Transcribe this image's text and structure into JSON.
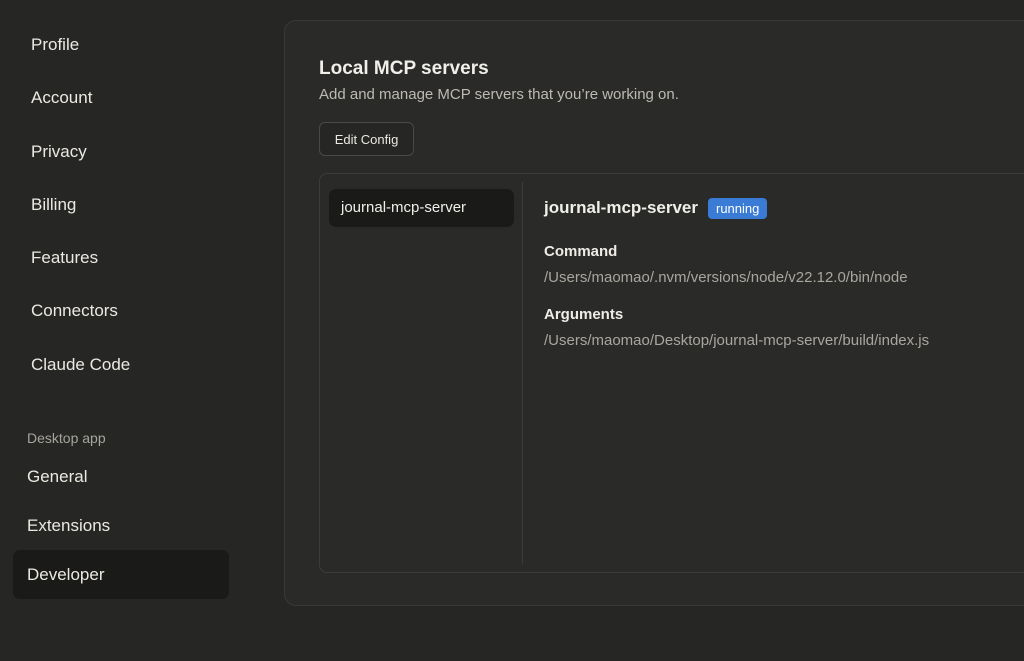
{
  "sidebar": {
    "items": [
      {
        "label": "Profile"
      },
      {
        "label": "Account"
      },
      {
        "label": "Privacy"
      },
      {
        "label": "Billing"
      },
      {
        "label": "Features"
      },
      {
        "label": "Connectors"
      },
      {
        "label": "Claude Code"
      }
    ],
    "section_label": "Desktop app",
    "app_items": [
      {
        "label": "General"
      },
      {
        "label": "Extensions"
      },
      {
        "label": "Developer",
        "active": true
      }
    ]
  },
  "main": {
    "title": "Local MCP servers",
    "subtitle": "Add and manage MCP servers that you’re working on.",
    "edit_config_label": "Edit Config",
    "servers": [
      {
        "name": "journal-mcp-server"
      }
    ],
    "detail": {
      "name": "journal-mcp-server",
      "status": "running",
      "command_label": "Command",
      "command_value": "/Users/maomao/.nvm/versions/node/v22.12.0/bin/node",
      "arguments_label": "Arguments",
      "arguments_value": "/Users/maomao/Desktop/journal-mcp-server/build/index.js"
    }
  },
  "colors": {
    "background": "#262624",
    "status_badge": "#3a7bd5",
    "active_item": "#1a1a18"
  }
}
